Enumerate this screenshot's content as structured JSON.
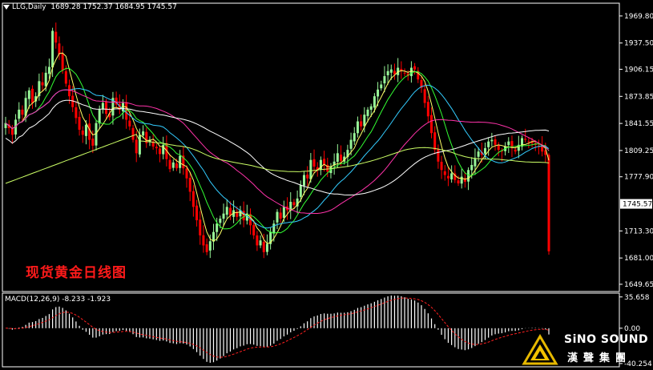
{
  "header": {
    "symbol": "LLG,Daily",
    "ohlc": "1689.28 1752.37 1684.95 1745.57"
  },
  "title_cn": "现货黄金日线图",
  "macd_label": "MACD(12,26,9) -8.233 -1.923",
  "brand": {
    "en": "SiNO SOUND",
    "zh": "漢聲集團"
  },
  "colors": {
    "background": "#000000",
    "bull": "#98f598",
    "bear": "#ff0000",
    "grid_axis": "#ffffff",
    "current_price_bg": "#ffffff",
    "ma_colors": [
      "#ffff66",
      "#33ff33",
      "#33ccff",
      "#ff33aa",
      "#ffffff",
      "#ccff66"
    ]
  },
  "chart_data": [
    {
      "type": "candlestick",
      "name": "price",
      "y_ticks": [
        "1969.80",
        "1937.50",
        "1906.15",
        "1873.85",
        "1841.55",
        "1809.25",
        "1777.90",
        "1713.30",
        "1681.00",
        "1649.65"
      ],
      "y_tick_values": [
        1969.8,
        1937.5,
        1906.15,
        1873.85,
        1841.55,
        1809.25,
        1777.9,
        1713.3,
        1681.0,
        1649.65
      ],
      "ylim": [
        1641,
        1985
      ],
      "current_price": "1745.57",
      "current_price_value": 1745.57,
      "approx_close_path": [
        1842,
        1836,
        1828,
        1846,
        1858,
        1852,
        1872,
        1881,
        1866,
        1874,
        1892,
        1887,
        1902,
        1909,
        1952,
        1938,
        1924,
        1905,
        1889,
        1874,
        1861,
        1848,
        1834,
        1828,
        1840,
        1822,
        1815,
        1842,
        1858,
        1866,
        1853,
        1849,
        1872,
        1864,
        1858,
        1866,
        1846,
        1838,
        1822,
        1806,
        1828,
        1832,
        1818,
        1822,
        1814,
        1812,
        1805,
        1816,
        1799,
        1787,
        1795,
        1788,
        1803,
        1788,
        1776,
        1760,
        1742,
        1726,
        1708,
        1696,
        1688,
        1701,
        1712,
        1722,
        1728,
        1734,
        1742,
        1732,
        1738,
        1730,
        1738,
        1726,
        1734,
        1720,
        1708,
        1696,
        1702,
        1688,
        1698,
        1712,
        1722,
        1736,
        1728,
        1742,
        1738,
        1748,
        1744,
        1752,
        1768,
        1780,
        1776,
        1798,
        1790,
        1786,
        1798,
        1792,
        1784,
        1790,
        1796,
        1806,
        1797,
        1802,
        1810,
        1822,
        1830,
        1844,
        1838,
        1852,
        1858,
        1862,
        1874,
        1882,
        1888,
        1898,
        1904,
        1906,
        1900,
        1908,
        1904,
        1902,
        1898,
        1908,
        1906,
        1894,
        1884,
        1866,
        1850,
        1830,
        1810,
        1796,
        1786,
        1780,
        1776,
        1782,
        1774,
        1770,
        1778,
        1772,
        1786,
        1792,
        1800,
        1808,
        1804,
        1812,
        1820,
        1822,
        1816,
        1810,
        1808,
        1814,
        1820,
        1812,
        1808,
        1816,
        1824,
        1822,
        1820,
        1818,
        1816,
        1814,
        1808,
        1804,
        1745
      ]
    },
    {
      "type": "bar",
      "name": "macd",
      "signal_name": "signal",
      "y_ticks": [
        "35.658",
        "0.00",
        "-40.254"
      ],
      "y_tick_values": [
        35.658,
        0.0,
        -40.254
      ],
      "ylim": [
        -44,
        40
      ],
      "value": -8.233,
      "signal": -1.923
    }
  ]
}
